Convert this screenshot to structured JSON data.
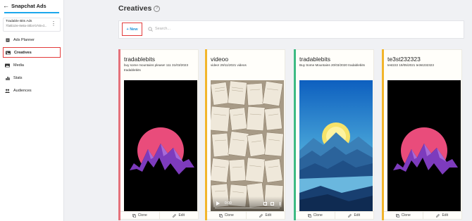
{
  "sidebar": {
    "title": "Snapchat Ads",
    "account_name": "Tradable Bits Ads",
    "account_id": "7fa5b10e-8e8a-40b4-b745-d...",
    "items": [
      {
        "label": "Ads Planner",
        "icon": "document-icon"
      },
      {
        "label": "Creatives",
        "icon": "palette-icon"
      },
      {
        "label": "Media",
        "icon": "image-icon"
      },
      {
        "label": "Stats",
        "icon": "bar-chart-icon"
      },
      {
        "label": "Audiences",
        "icon": "people-icon"
      }
    ],
    "active_item": "Creatives"
  },
  "header": {
    "title": "Creatives",
    "help": "?"
  },
  "toolbar": {
    "new_label": "+ New",
    "search_placeholder": "Search..."
  },
  "cards": [
    {
      "title": "tradablebits",
      "description": "buy some mountains please! 111 31/03/2023 tradablebits",
      "stripe_color": "#e5727b",
      "media": "mountain-sunset-image",
      "clone_label": "Clone",
      "edit_label": "Edit"
    },
    {
      "title": "videoo",
      "description": "video! 29/11/2021 videos",
      "stripe_color": "#f2b52c",
      "media": "book-pages-video",
      "video_time": "0:00",
      "clone_label": "Clone",
      "edit_label": "Edit"
    },
    {
      "title": "tradablebits",
      "description": "Buy Some Mountains 20/03/2020 tradablebits",
      "stripe_color": "#3dba83",
      "media": "blue-mountain-lake-image",
      "clone_label": "Clone",
      "edit_label": "Edit"
    },
    {
      "title": "te3st232323",
      "description": "test222 19/05/2021 te3st232323",
      "stripe_color": "#f2b52c",
      "media": "mountain-sunset-image",
      "clone_label": "Clone",
      "edit_label": "Edit"
    }
  ]
}
